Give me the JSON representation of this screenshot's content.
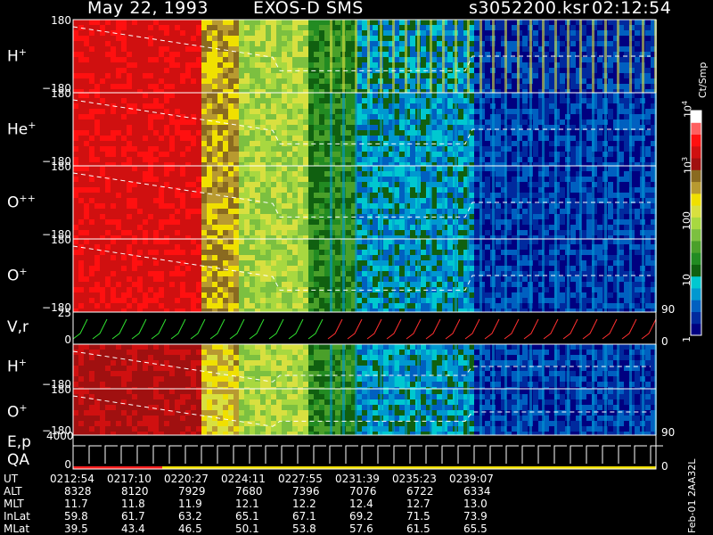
{
  "header": {
    "date": "May 22, 1993",
    "instrument": "EXOS-D SMS",
    "file": "s3052200.ksr",
    "time": "02:12:54"
  },
  "chart_data": {
    "type": "heatmap",
    "panels": [
      {
        "label_main": "H",
        "label_sup": "+",
        "ymax": "180",
        "ymin": "−180"
      },
      {
        "label_main": "He",
        "label_sup": "+",
        "ymax": "180",
        "ymin": "−180"
      },
      {
        "label_main": "O",
        "label_sup": "++",
        "ymax": "180",
        "ymin": "−180"
      },
      {
        "label_main": "O",
        "label_sup": "+",
        "ymax": "180",
        "ymin": "−180",
        "right_tick": "90"
      },
      {
        "label_main": "V,r",
        "label_sup": "",
        "ymax": "25",
        "ymin": "0",
        "right_tick": "0"
      },
      {
        "label_main": "H",
        "label_sup": "+",
        "ymax": "",
        "ymin": "−180"
      },
      {
        "label_main": "O",
        "label_sup": "+",
        "ymax": "180",
        "ymin": "−180",
        "right_tick": "90"
      },
      {
        "label_main": "E,p",
        "label2": "QA",
        "ymax": "4000",
        "ymin": "0",
        "right_tick": "0"
      }
    ],
    "colorbar": {
      "unit": "Ct/Smp",
      "ticks": [
        {
          "label": "10",
          "sup": "4",
          "value": 4
        },
        {
          "label": "10",
          "sup": "3",
          "value": 3
        },
        {
          "label": "100",
          "sup": "",
          "value": 2
        },
        {
          "label": "10",
          "sup": "",
          "value": 1
        },
        {
          "label": "1",
          "sup": "",
          "value": 0
        }
      ],
      "colors": [
        "#000080",
        "#002a9e",
        "#0060c0",
        "#0098d0",
        "#00c8d0",
        "#106010",
        "#228b22",
        "#4aa02a",
        "#7cc040",
        "#a8d840",
        "#d8e040",
        "#f0e000",
        "#b89a30",
        "#8a6a20",
        "#a01010",
        "#d01010",
        "#ff1010",
        "#ff6060",
        "#ffffff"
      ]
    },
    "time_table": {
      "rows": [
        {
          "name": "UT",
          "values": [
            "0212:54",
            "0217:10",
            "0220:27",
            "0224:11",
            "0227:55",
            "0231:39",
            "0235:23",
            "0239:07"
          ]
        },
        {
          "name": "ALT",
          "values": [
            "8328",
            "8120",
            "7929",
            "7680",
            "7396",
            "7076",
            "6722",
            "6334"
          ]
        },
        {
          "name": "MLT",
          "values": [
            "11.7",
            "11.8",
            "11.9",
            "12.1",
            "12.2",
            "12.4",
            "12.7",
            "13.0"
          ]
        },
        {
          "name": "InLat",
          "values": [
            "59.8",
            "61.7",
            "63.2",
            "65.1",
            "67.1",
            "69.2",
            "71.5",
            "73.9"
          ]
        },
        {
          "name": "MLat",
          "values": [
            "39.5",
            "43.4",
            "46.5",
            "50.1",
            "53.8",
            "57.6",
            "61.5",
            "65.5"
          ]
        }
      ]
    },
    "footer": "Feb-01 2AA32L"
  }
}
